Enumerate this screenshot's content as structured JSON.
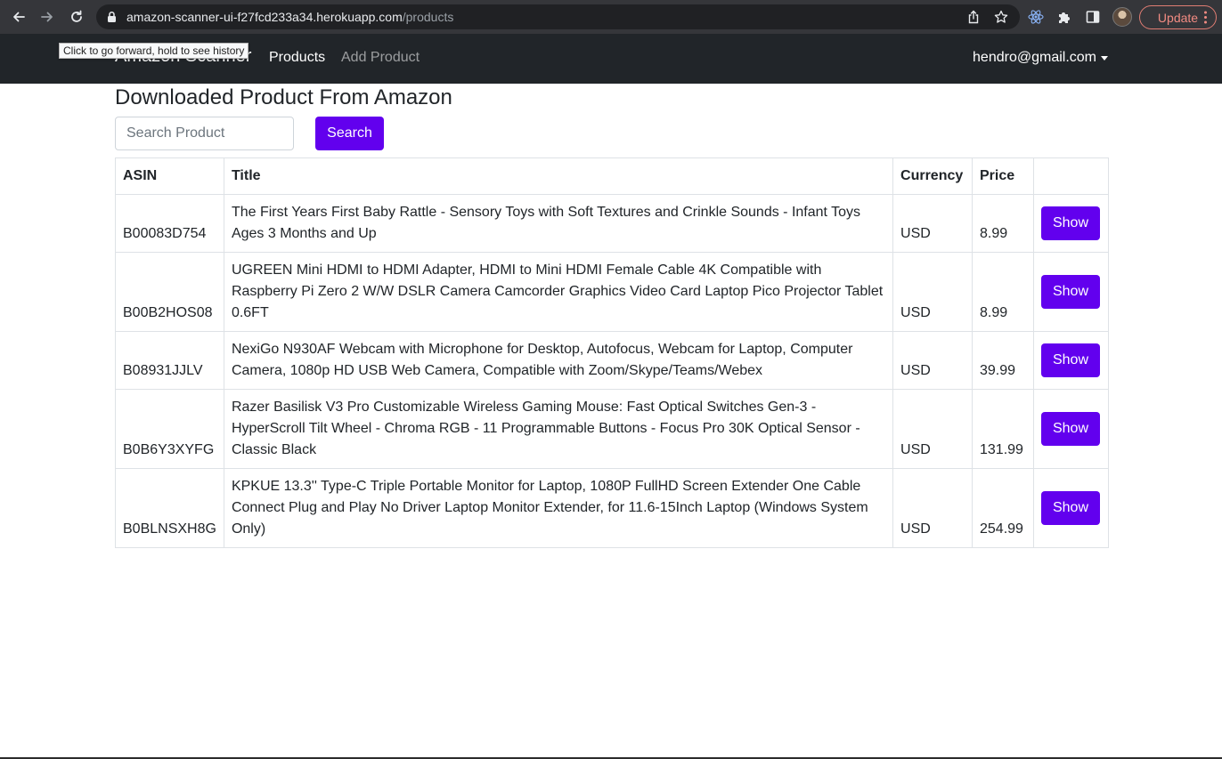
{
  "browser": {
    "url_host": "amazon-scanner-ui-f27fcd233a34.herokuapp.com",
    "url_path": "/products",
    "update_label": "Update",
    "tooltip": "Click to go forward, hold to see history"
  },
  "navbar": {
    "brand": "Amazon Scanner",
    "links": [
      {
        "label": "Products"
      },
      {
        "label": "Add Product"
      }
    ],
    "user_email": "hendro@gmail.com"
  },
  "main": {
    "title": "Downloaded Product From Amazon",
    "search_placeholder": "Search Product",
    "search_button": "Search"
  },
  "table": {
    "headers": [
      "ASIN",
      "Title",
      "Currency",
      "Price",
      ""
    ],
    "rows": [
      {
        "asin": "B00083D754",
        "title": "The First Years First Baby Rattle - Sensory Toys with Soft Textures and Crinkle Sounds - Infant Toys Ages 3 Months and Up",
        "currency": "USD",
        "price": "8.99",
        "action": "Show"
      },
      {
        "asin": "B00B2HOS08",
        "title": "UGREEN Mini HDMI to HDMI Adapter, HDMI to Mini HDMI Female Cable 4K Compatible with Raspberry Pi Zero 2 W/W DSLR Camera Camcorder Graphics Video Card Laptop Pico Projector Tablet 0.6FT",
        "currency": "USD",
        "price": "8.99",
        "action": "Show"
      },
      {
        "asin": "B08931JJLV",
        "title": "NexiGo N930AF Webcam with Microphone for Desktop, Autofocus, Webcam for Laptop, Computer Camera, 1080p HD USB Web Camera, Compatible with Zoom/Skype/Teams/Webex",
        "currency": "USD",
        "price": "39.99",
        "action": "Show"
      },
      {
        "asin": "B0B6Y3XYFG",
        "title": "Razer Basilisk V3 Pro Customizable Wireless Gaming Mouse: Fast Optical Switches Gen-3 - HyperScroll Tilt Wheel - Chroma RGB - 11 Programmable Buttons - Focus Pro 30K Optical Sensor - Classic Black",
        "currency": "USD",
        "price": "131.99",
        "action": "Show"
      },
      {
        "asin": "B0BLNSXH8G",
        "title": "KPKUE 13.3'' Type-C Triple Portable Monitor for Laptop, 1080P FullHD Screen Extender One Cable Connect Plug and Play No Driver Laptop Monitor Extender, for 11.6-15Inch Laptop (Windows System Only)",
        "currency": "USD",
        "price": "254.99",
        "action": "Show"
      }
    ]
  },
  "icons": [
    "back-arrow-icon",
    "forward-arrow-icon",
    "reload-icon",
    "lock-icon",
    "share-icon",
    "star-icon",
    "react-devtools-icon",
    "puzzle-icon",
    "side-panel-icon",
    "chevron-down-icon"
  ],
  "colors": {
    "accent": "#6200ee",
    "navbar": "#212529",
    "chrome": "#35363a"
  }
}
